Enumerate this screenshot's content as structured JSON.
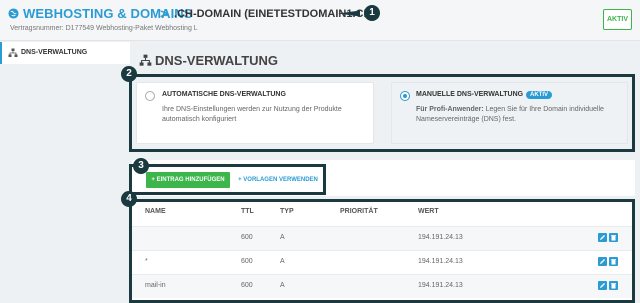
{
  "header": {
    "title": "WEBHOSTING & DOMAINS",
    "separator": ">",
    "domain": ".CH-DOMAIN (EINETESTDOMAIN1.CH)",
    "contract": "Vertragsnummer: D177549 Webhosting-Paket Webhosting L",
    "status_button": "AKTIV"
  },
  "sidebar": {
    "items": [
      {
        "label": "DNS-VERWALTUNG",
        "icon": "sitemap-icon"
      }
    ]
  },
  "page": {
    "title": "DNS-VERWALTUNG"
  },
  "options": [
    {
      "title": "AUTOMATISCHE DNS-VERWALTUNG",
      "desc_line1": "Ihre DNS-Einstellungen werden zur Nutzung der Produkte",
      "desc_line2": "automatisch konfiguriert",
      "selected": false
    },
    {
      "title": "MANUELLE DNS-VERWALTUNG",
      "badge": "AKTIV",
      "desc_bold": "Für Profi-Anwender:",
      "desc_line1": " Legen Sie für Ihre Domain individuelle",
      "desc_line2": "Nameservereinträge (DNS) fest.",
      "selected": true
    }
  ],
  "actions": {
    "add": "+ EINTRAG HINZUFÜGEN",
    "template": "+ VORLAGEN VERWENDEN"
  },
  "table": {
    "headers": [
      "NAME",
      "TTL",
      "TYP",
      "PRIORITÄT",
      "WERT"
    ],
    "rows": [
      {
        "name": "",
        "ttl": "600",
        "type": "A",
        "priority": "",
        "value": "194.191.24.13"
      },
      {
        "name": "*",
        "ttl": "600",
        "type": "A",
        "priority": "",
        "value": "194.191.24.13"
      },
      {
        "name": "mail-in",
        "ttl": "600",
        "type": "A",
        "priority": "",
        "value": "194.191.24.13"
      }
    ]
  },
  "markers": [
    "1",
    "2",
    "3",
    "4"
  ],
  "colors": {
    "accent": "#2b9bd3",
    "green": "#3cb54a",
    "annotation": "#1a3a40"
  }
}
